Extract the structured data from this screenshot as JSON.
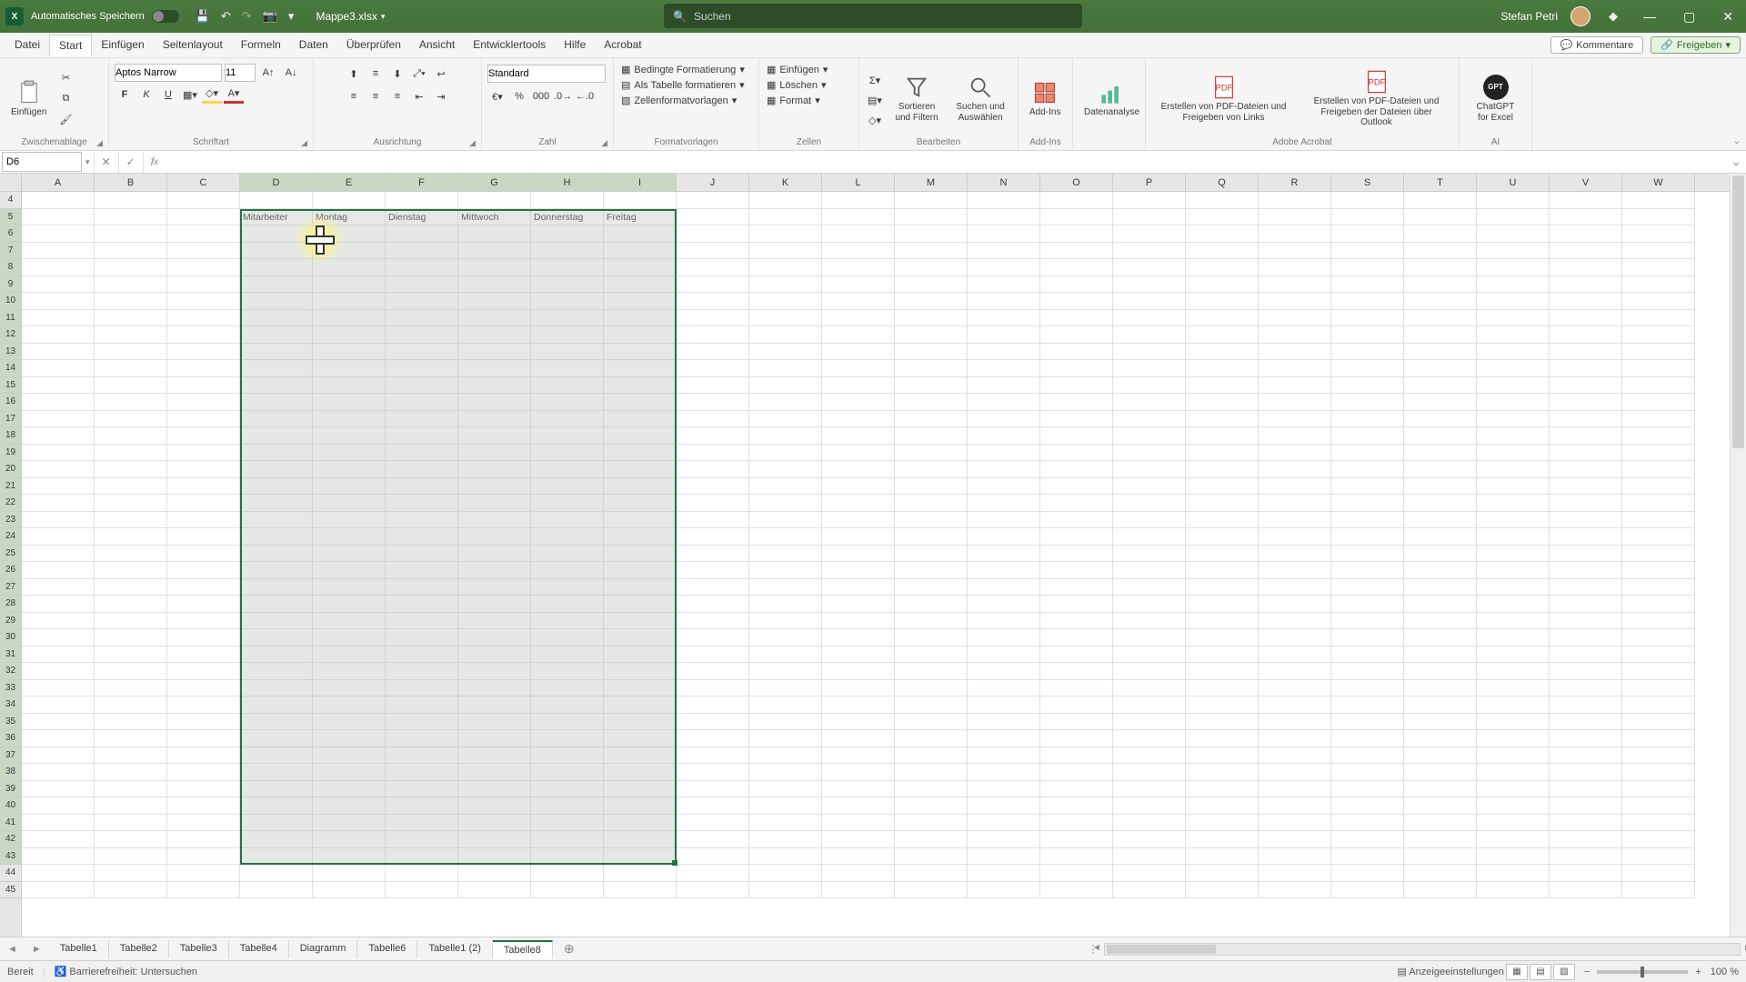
{
  "title": {
    "autosave": "Automatisches Speichern",
    "doc_name": "Mappe3.xlsx",
    "search_placeholder": "Suchen",
    "user_name": "Stefan Petri"
  },
  "menu": {
    "tabs": [
      "Datei",
      "Start",
      "Einfügen",
      "Seitenlayout",
      "Formeln",
      "Daten",
      "Überprüfen",
      "Ansicht",
      "Entwicklertools",
      "Hilfe",
      "Acrobat"
    ],
    "kommentare": "Kommentare",
    "freigeben": "Freigeben"
  },
  "ribbon": {
    "clipboard": {
      "paste": "Einfügen",
      "label": "Zwischenablage"
    },
    "font": {
      "name": "Aptos Narrow",
      "size": "11",
      "label": "Schriftart"
    },
    "alignment": {
      "label": "Ausrichtung"
    },
    "number": {
      "format": "Standard",
      "label": "Zahl"
    },
    "styles": {
      "cond": "Bedingte Formatierung",
      "astable": "Als Tabelle formatieren",
      "cellstyles": "Zellenformatvorlagen",
      "label": "Formatvorlagen"
    },
    "cells": {
      "insert": "Einfügen",
      "delete": "Löschen",
      "format": "Format",
      "label": "Zellen"
    },
    "editing": {
      "sortfilter": "Sortieren und Filtern",
      "findselect": "Suchen und Auswählen",
      "label": "Bearbeiten"
    },
    "addins": {
      "btn": "Add-Ins",
      "label": "Add-Ins"
    },
    "analysis": {
      "btn": "Datenanalyse"
    },
    "acrobat1": "Erstellen von PDF-Dateien und Freigeben von Links",
    "acrobat2": "Erstellen von PDF-Dateien und Freigeben der Dateien über Outlook",
    "acrobat_label": "Adobe Acrobat",
    "gpt": "ChatGPT for Excel",
    "gpt_label": "AI"
  },
  "formulabar": {
    "namebox": "D6"
  },
  "grid": {
    "first_row": 4,
    "columns": [
      "A",
      "B",
      "C",
      "D",
      "E",
      "F",
      "G",
      "H",
      "I",
      "J",
      "K",
      "L",
      "M",
      "N",
      "O",
      "P",
      "Q",
      "R",
      "S",
      "T",
      "U",
      "V",
      "W"
    ],
    "selected_cols": [
      "D",
      "E",
      "F",
      "G",
      "H",
      "I"
    ],
    "headers": {
      "D": "Mitarbeiter",
      "E": "Montag",
      "F": "Dienstag",
      "G": "Mittwoch",
      "H": "Donnerstag",
      "I": "Freitag"
    }
  },
  "sheets": {
    "tabs": [
      "Tabelle1",
      "Tabelle2",
      "Tabelle3",
      "Tabelle4",
      "Diagramm",
      "Tabelle6",
      "Tabelle1 (2)",
      "Tabelle8"
    ],
    "active": "Tabelle8"
  },
  "status": {
    "ready": "Bereit",
    "access": "Barrierefreiheit: Untersuchen",
    "display": "Anzeigeeinstellungen",
    "zoom": "100 %"
  }
}
